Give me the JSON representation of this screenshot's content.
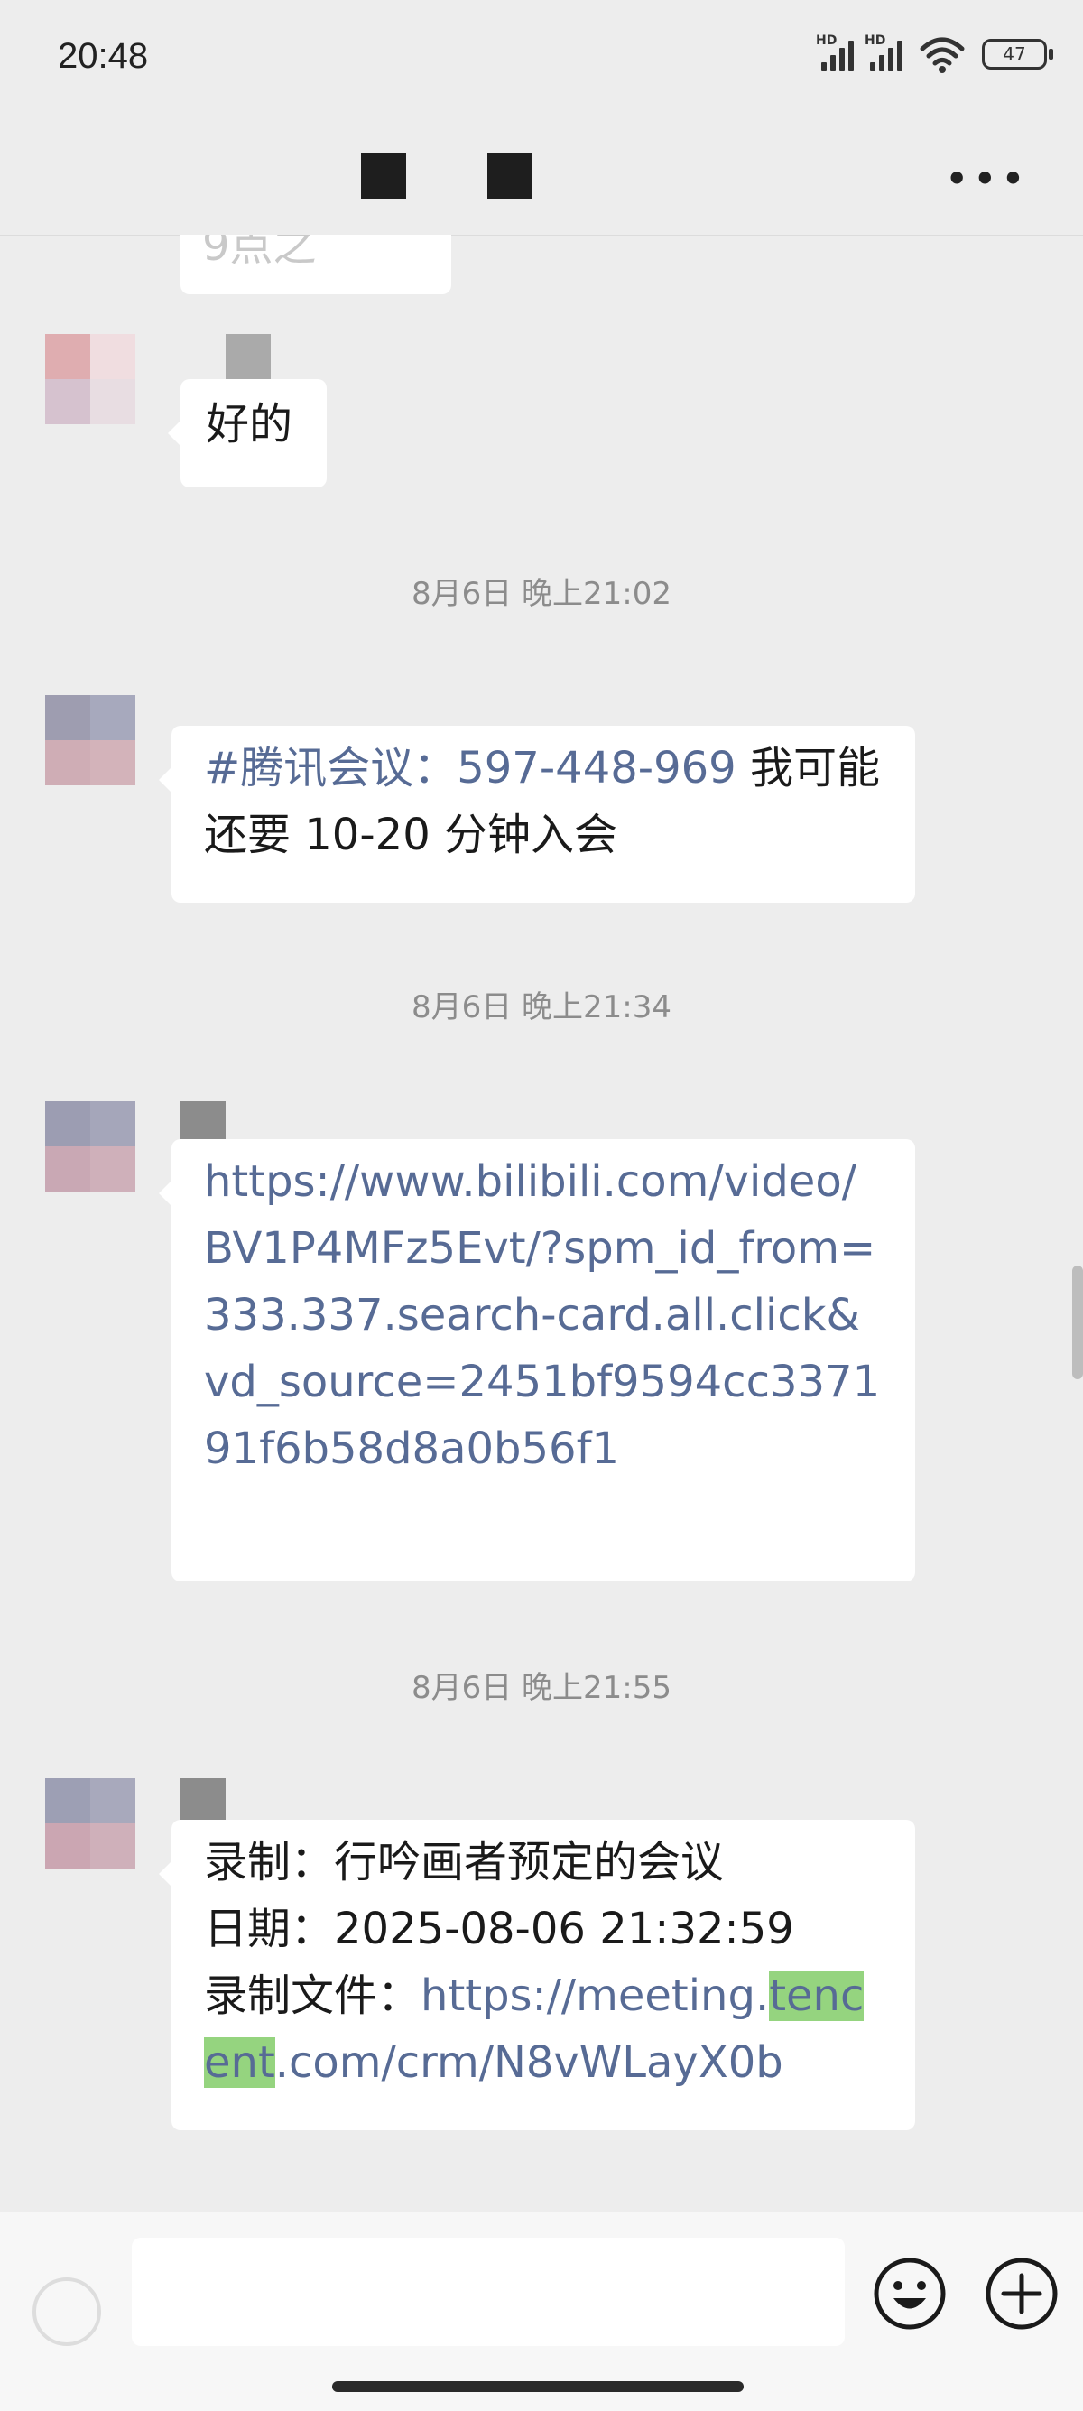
{
  "status_bar": {
    "time": "20:48",
    "signal_1_label": "HD",
    "signal_2_label": "HD",
    "battery_level": "47"
  },
  "header": {
    "more_icon": "more-horizontal-icon"
  },
  "messages": [
    {
      "type": "text",
      "text": "好的"
    },
    {
      "type": "timestamp",
      "text": "8月6日 晚上21:02"
    },
    {
      "type": "rich",
      "parts": [
        {
          "kind": "link",
          "text": "#腾讯会议：597-448-969"
        },
        {
          "kind": "text",
          "text": " 我可能还要 10-20 分钟入会"
        }
      ]
    },
    {
      "type": "timestamp",
      "text": "8月6日 晚上21:34"
    },
    {
      "type": "link",
      "text": "https://www.bilibili.com/video/BV1P4MFz5Evt/?spm_id_from=333.337.search-card.all.click&vd_source=2451bf9594cc337191f6b58d8a0b56f1"
    },
    {
      "type": "timestamp",
      "text": "8月6日 晚上21:55"
    },
    {
      "type": "rich",
      "lines": {
        "line1": "录制：行吟画者预定的会议",
        "line2": "日期：2025-08-06 21:32:59",
        "line3_label": "录制文件：",
        "link_part1": "https://meeting.",
        "link_highlight": "tencent",
        "link_part2": ".com/crm/N8vWLayX0b"
      }
    }
  ],
  "input_bar": {
    "placeholder": "",
    "voice_icon": "voice-icon",
    "emoji_icon": "emoji-icon",
    "plus_icon": "plus-icon"
  },
  "colors": {
    "background": "#ededed",
    "bubble": "#ffffff",
    "link": "#576b95",
    "highlight": "#95d47f"
  }
}
